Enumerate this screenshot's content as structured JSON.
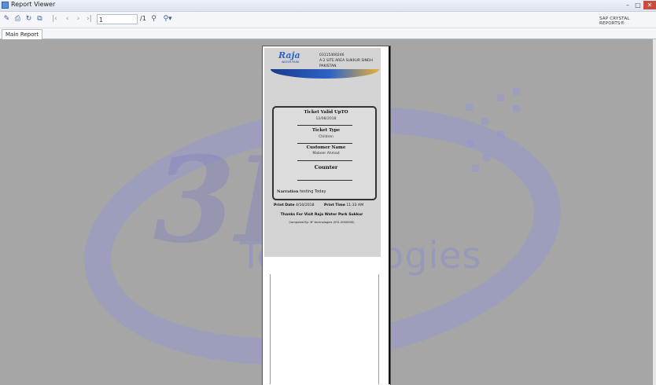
{
  "window": {
    "title": "Report Viewer"
  },
  "toolbar": {
    "page_value": "1",
    "page_total": "/1",
    "brand_label": "SAP CRYSTAL REPORTS®"
  },
  "tabs": [
    {
      "label": "Main Report"
    }
  ],
  "watermark": {
    "logo_text": "3F",
    "company_text": "Technologies"
  },
  "ticket": {
    "header_lines": [
      "03115400246",
      "A-2 SITE AREA SUKKUR SINDH",
      "PAKISTAN"
    ],
    "logo_text": "Raja",
    "logo_sub": "WATER PARK",
    "valid_upto_label": "Ticket Valid UpTO",
    "valid_upto_value": "12/08/2018",
    "type_label": "Ticket Type",
    "type_value": "Children",
    "customer_label": "Customer Name",
    "customer_value": "Mabeer Ahmad",
    "counter_label": "Counter",
    "counter_value": "",
    "narration_label": "Narration",
    "narration_value": "testing Today",
    "print_date_label": "Print Date",
    "print_date_value": "4/10/2018",
    "print_time_label": "Print Time",
    "print_time_value": "11:33 AM",
    "thanks": "Thanks For Visit Raja Water Park Sukkur",
    "powered_by": "Computed By: 3F technologies (031-0000000)"
  }
}
